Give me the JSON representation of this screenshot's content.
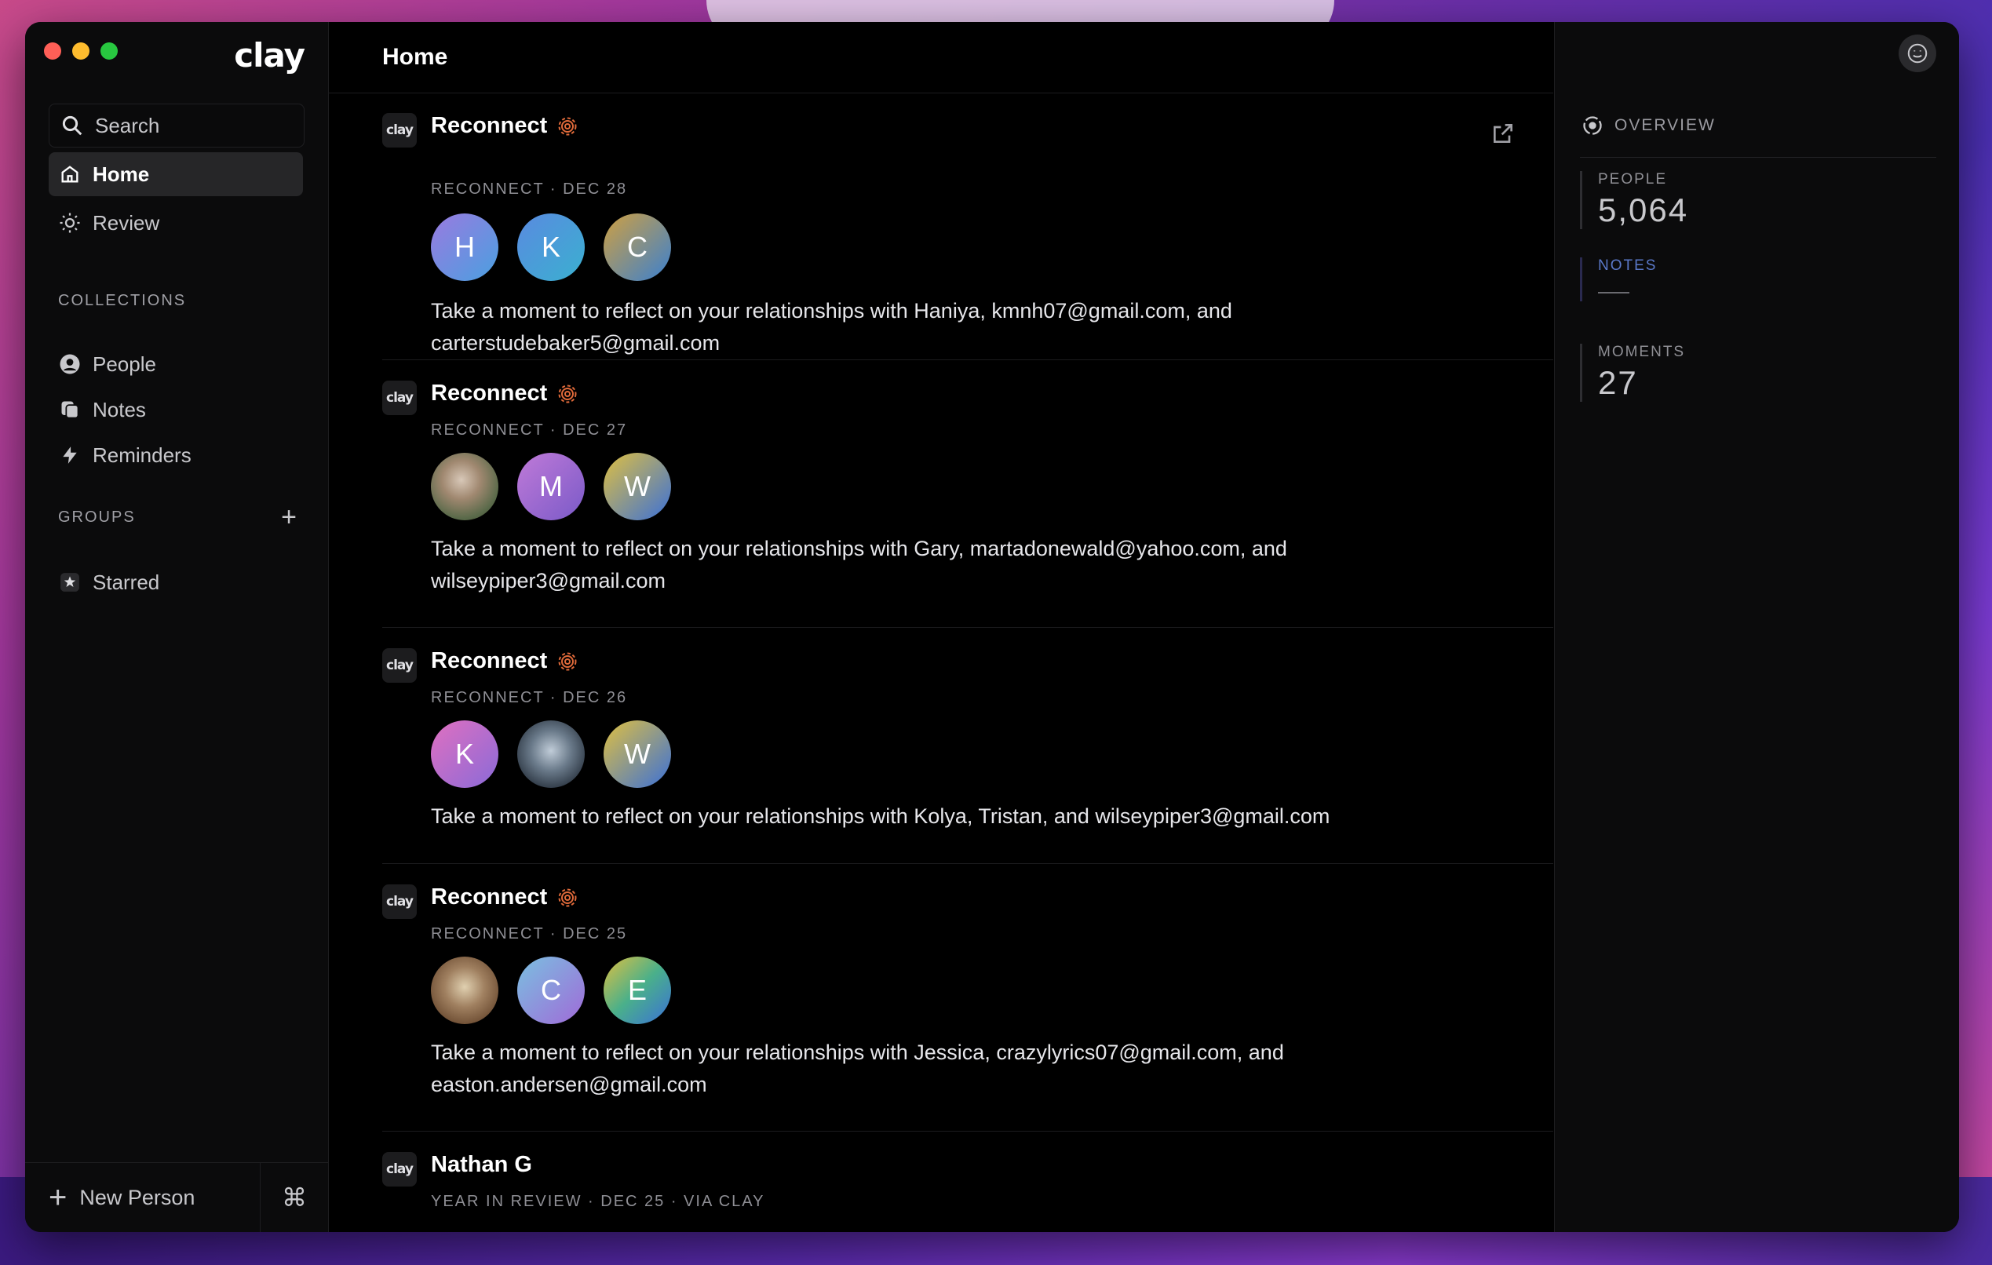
{
  "app": {
    "logo": "clay"
  },
  "sidebar": {
    "search_placeholder": "Search",
    "nav": [
      {
        "label": "Home",
        "icon": "home-icon",
        "active": true
      },
      {
        "label": "Review",
        "icon": "sun-icon",
        "active": false
      }
    ],
    "collections_label": "COLLECTIONS",
    "collections": [
      {
        "label": "People",
        "icon": "person-circle-icon"
      },
      {
        "label": "Notes",
        "icon": "notes-icon"
      },
      {
        "label": "Reminders",
        "icon": "bolt-icon"
      }
    ],
    "groups_label": "GROUPS",
    "groups": [
      {
        "label": "Starred",
        "icon": "star-icon"
      }
    ],
    "new_person_label": "New Person",
    "shortcut_symbol": "⌘"
  },
  "main": {
    "title": "Home",
    "cards": [
      {
        "logo": "clay",
        "title": "Reconnect",
        "meta": "RECONNECT · DEC 28",
        "avatars": [
          {
            "letter": "H",
            "color": "#6f8fe0"
          },
          {
            "letter": "K",
            "color": "#4aa0d8"
          },
          {
            "letter": "C",
            "color": "#6a9ad0"
          }
        ],
        "text": "Take a moment to reflect on your relationships with Haniya, kmnh07@gmail.com, and carterstudebaker5@gmail.com"
      },
      {
        "logo": "clay",
        "title": "Reconnect",
        "meta": "RECONNECT · DEC 27",
        "avatars": [
          {
            "letter": "",
            "color": "#6b7a5a",
            "photo": true
          },
          {
            "letter": "M",
            "color": "#9a6ad0"
          },
          {
            "letter": "W",
            "color": "#4a8ad0"
          }
        ],
        "text": "Take a moment to reflect on your relationships with Gary, martadonewald@yahoo.com, and wilseypiper3@gmail.com"
      },
      {
        "logo": "clay",
        "title": "Reconnect",
        "meta": "RECONNECT · DEC 26",
        "avatars": [
          {
            "letter": "K",
            "color": "#c06ad0"
          },
          {
            "letter": "",
            "color": "#3a4a5a",
            "photo": true
          },
          {
            "letter": "W",
            "color": "#4a8ad0"
          }
        ],
        "text": "Take a moment to reflect on your relationships with Kolya, Tristan, and wilseypiper3@gmail.com"
      },
      {
        "logo": "clay",
        "title": "Reconnect",
        "meta": "RECONNECT · DEC 25",
        "avatars": [
          {
            "letter": "",
            "color": "#8a6a4a",
            "photo": true
          },
          {
            "letter": "C",
            "color": "#9a7ad8"
          },
          {
            "letter": "E",
            "color": "#5aa07a"
          }
        ],
        "text": "Take a moment to reflect on your relationships with Jessica, crazylyrics07@gmail.com, and easton.andersen@gmail.com"
      },
      {
        "logo": "clay",
        "title": "Nathan G",
        "meta": "YEAR IN REVIEW · DEC 25 · VIA CLAY",
        "avatars": [],
        "text": ""
      }
    ]
  },
  "right": {
    "overview_label": "OVERVIEW",
    "stats": [
      {
        "label": "PEOPLE",
        "value": "5,064"
      },
      {
        "label": "NOTES",
        "value": ""
      },
      {
        "label": "MOMENTS",
        "value": "27"
      }
    ]
  },
  "colors": {
    "accent_pin": "#e06a3a",
    "active_bg": "#262628"
  }
}
